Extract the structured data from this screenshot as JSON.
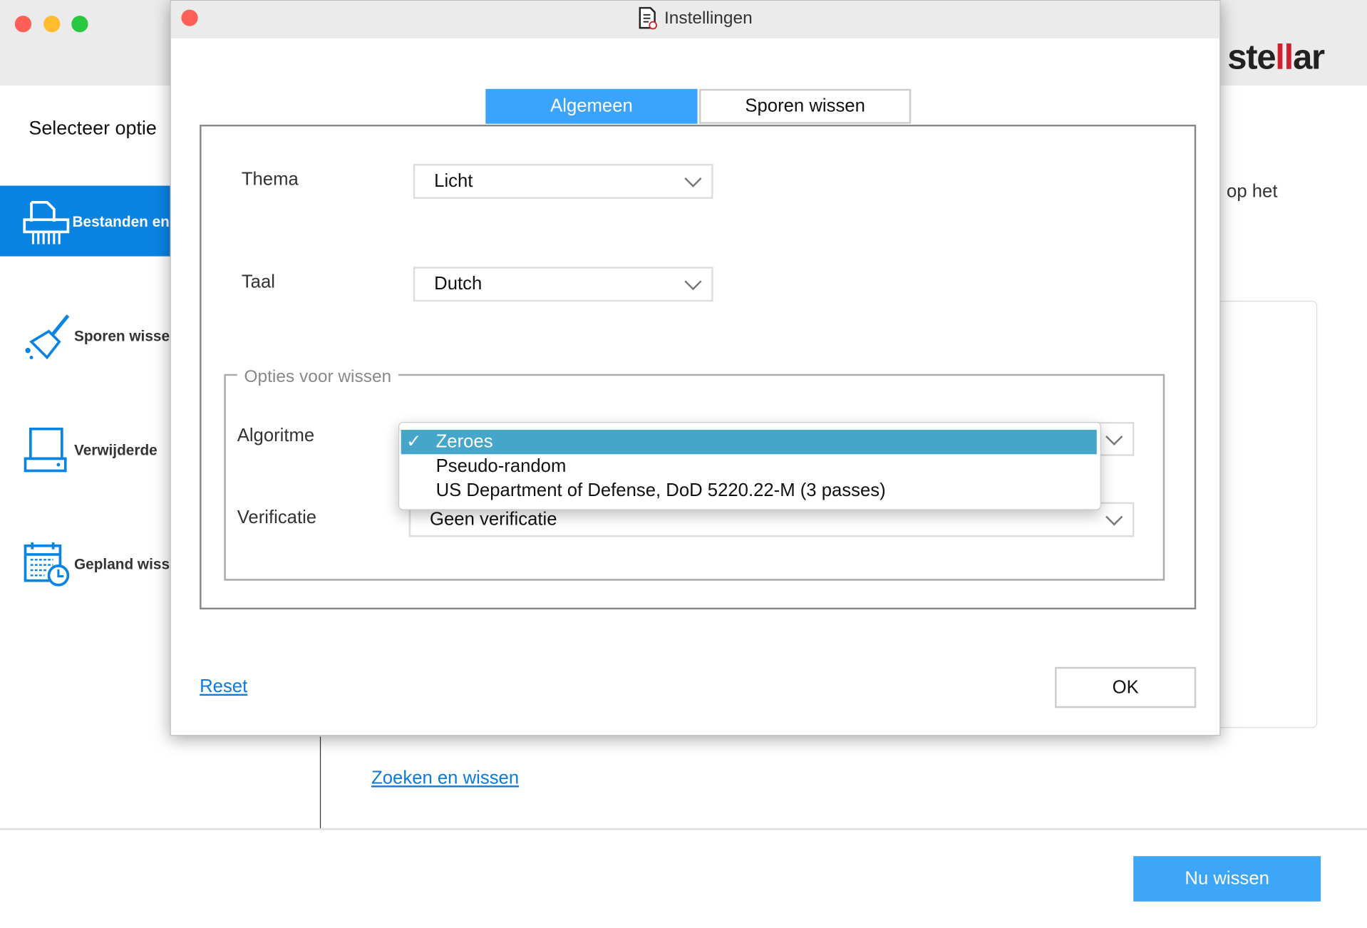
{
  "app": {
    "sidebar": {
      "title": "Selecteer optie",
      "items": [
        {
          "label": "Bestanden en",
          "icon": "shredder-icon",
          "active": true
        },
        {
          "label": "Sporen wisse",
          "icon": "broom-icon",
          "active": false
        },
        {
          "label": "Verwijderde",
          "icon": "drive-icon",
          "active": false
        },
        {
          "label": "Gepland wiss",
          "icon": "calendar-clock-icon",
          "active": false
        }
      ]
    },
    "logo": {
      "text_pre": "ste",
      "text_mark": "ll",
      "text_post": "ar"
    },
    "right_text": "op het",
    "search_link": "Zoeken en wissen",
    "erase_button": "Nu wissen",
    "colors": {
      "accent": "#0a84e3",
      "button": "#3ea6f8",
      "logo_red": "#d2202f"
    }
  },
  "dialog": {
    "title": "Instellingen",
    "tabs": [
      {
        "label": "Algemeen",
        "active": true
      },
      {
        "label": "Sporen wissen",
        "active": false
      }
    ],
    "theme": {
      "label": "Thema",
      "value": "Licht"
    },
    "language": {
      "label": "Taal",
      "value": "Dutch"
    },
    "wipe_options": {
      "legend": "Opties voor wissen",
      "algorithm": {
        "label": "Algoritme",
        "options": [
          "Zeroes",
          "Pseudo-random",
          "US Department of Defense, DoD 5220.22-M (3 passes)"
        ],
        "selected": "Zeroes",
        "check": "✓"
      },
      "verification": {
        "label": "Verificatie",
        "value": "Geen verificatie"
      }
    },
    "reset_link": "Reset",
    "ok_button": "OK",
    "colors": {
      "tab_active": "#3aa3fb",
      "highlight": "#46a6c9"
    }
  }
}
